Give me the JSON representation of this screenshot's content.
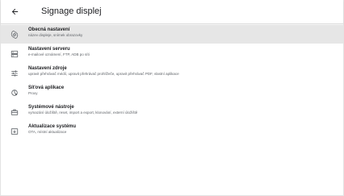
{
  "header": {
    "title": "Signage displej",
    "back_icon": "back-arrow-icon"
  },
  "menu": {
    "items": [
      {
        "label": "Obecná nastavení",
        "desc": "název displeje, snímek obrazovky",
        "icon": "gear-icon",
        "selected": true
      },
      {
        "label": "Nastavení serveru",
        "desc": "e-mailové oznámení, FTP, ADB po síti",
        "icon": "server-icon",
        "selected": false
      },
      {
        "label": "Nastavení zdroje",
        "desc": "upravit přehrávač médií, upravit přehrávač prohlížeče, upravit přehrávač PDF, vlastní aplikace",
        "icon": "sliders-icon",
        "selected": false
      },
      {
        "label": "Síťová aplikace",
        "desc": "Proxy",
        "icon": "network-icon",
        "selected": false
      },
      {
        "label": "Systémové nástroje",
        "desc": "vymazání úložiště, reset, import a export, klonování, externí úložiště",
        "icon": "toolbox-icon",
        "selected": false
      },
      {
        "label": "Aktualizace systému",
        "desc": "OTA, místní aktualizace",
        "icon": "system-update-icon",
        "selected": false
      }
    ]
  }
}
